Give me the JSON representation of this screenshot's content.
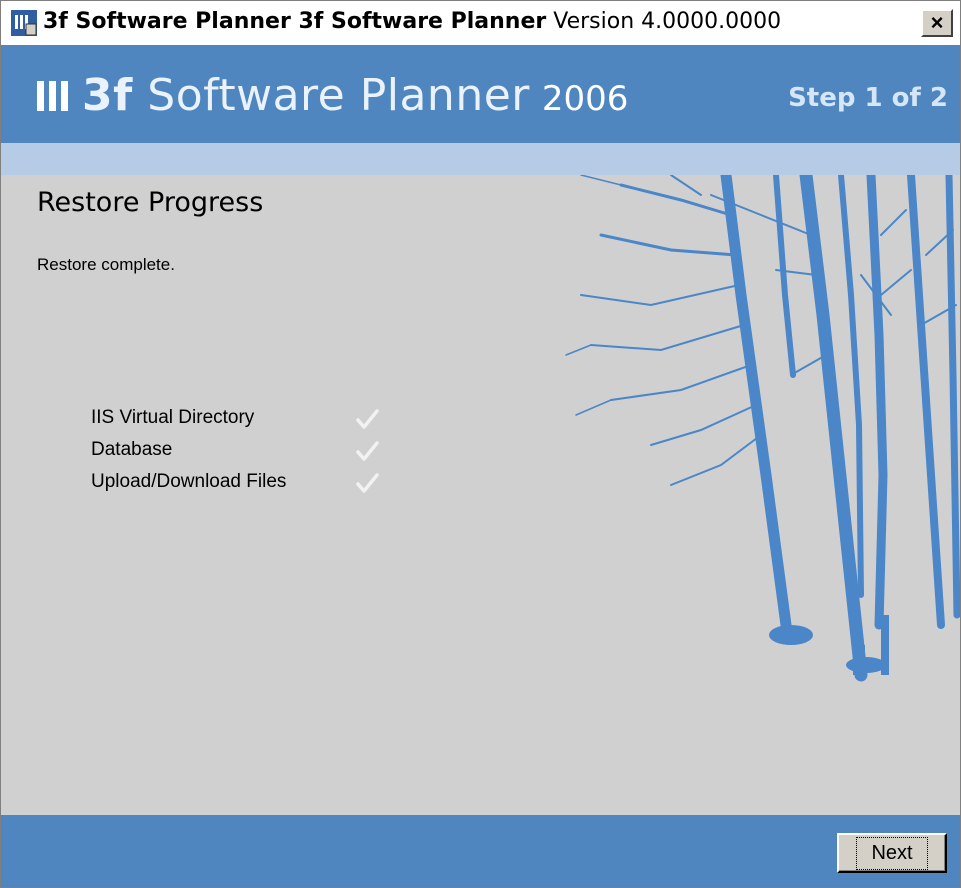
{
  "window": {
    "title_bold": "3f Software Planner 3f Software Planner",
    "title_version": "Version 4.0000.0000",
    "close_label": "×"
  },
  "header": {
    "brand_name_bold": "3f",
    "brand_name": "Software Planner",
    "brand_year": "2006",
    "step": "Step 1 of 2"
  },
  "main": {
    "title": "Restore Progress",
    "status": "Restore complete.",
    "items": [
      {
        "label": "IIS Virtual Directory",
        "status": "check-icon"
      },
      {
        "label": "Database",
        "status": "check-icon"
      },
      {
        "label": "Upload/Download Files",
        "status": "check-icon"
      }
    ]
  },
  "footer": {
    "next_label": "Next"
  },
  "colors": {
    "header_blue": "#4f86c0",
    "stripe_blue": "#b6cbe6",
    "body_gray": "#d0d0d0",
    "tree_blue": "#4a86c8"
  }
}
